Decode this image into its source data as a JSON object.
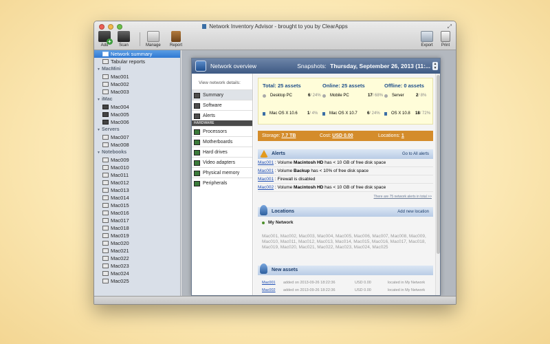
{
  "window": {
    "title": "Network Inventory Advisor - brought to you by ClearApps"
  },
  "toolbar": {
    "add": "Add",
    "scan": "Scan",
    "manage": "Manage",
    "report": "Report",
    "export": "Export",
    "print": "Print"
  },
  "sidebar": {
    "summary_items": [
      {
        "label": "Network summary",
        "icon": "network-icon"
      },
      {
        "label": "Tabular reports",
        "icon": "table-icon"
      }
    ],
    "groups": [
      {
        "name": "MacMini",
        "items": [
          "Mac001",
          "Mac002",
          "Mac003"
        ]
      },
      {
        "name": "iMac",
        "items": [
          "Mac004",
          "Mac005",
          "Mac006"
        ]
      },
      {
        "name": "Servers",
        "items": [
          "Mac007",
          "Mac008"
        ]
      },
      {
        "name": "Notebooks",
        "items": [
          "Mac009",
          "Mac010",
          "Mac011",
          "Mac012",
          "Mac013",
          "Mac014",
          "Mac015",
          "Mac016",
          "Mac017",
          "Mac018",
          "Mac019",
          "Mac020",
          "Mac021",
          "Mac022",
          "Mac023",
          "Mac024",
          "Mac025"
        ]
      }
    ]
  },
  "panel": {
    "title": "Network overview",
    "snapshot_label": "Snapshots:",
    "snapshot_value": "Thursday, September 26, 2013 (11:..."
  },
  "nav": {
    "caption": "View network details:",
    "items": [
      "Summary",
      "Software",
      "Alerts"
    ],
    "hardware_section": "HARDWARE",
    "hardware_items": [
      "Processors",
      "Motherboards",
      "Hard drives",
      "Video adapters",
      "Physical memory",
      "Peripherals"
    ]
  },
  "summary": {
    "total": "Total: 25 assets",
    "online": "Online: 25 assets",
    "offline": "Offline: 0 assets",
    "rows": [
      {
        "label": "Desktop PC",
        "value": "6",
        "pct": "/ 24%"
      },
      {
        "label": "Mobile PC",
        "value": "17",
        "pct": "/ 68%"
      },
      {
        "label": "Server",
        "value": "2",
        "pct": "/ 8%"
      },
      {
        "label": "Mac OS X 10.6",
        "value": "1",
        "pct": "/ 4%"
      },
      {
        "label": "Mac OS X 10.7",
        "value": "6",
        "pct": "/ 24%"
      },
      {
        "label": "OS X 10.8",
        "value": "18",
        "pct": "/ 72%"
      }
    ]
  },
  "storage": {
    "storage_label": "Storage:",
    "storage_value": "7.7 TB",
    "cost_label": "Cost:",
    "cost_value": "USD 0.00",
    "locations_label": "Locations:",
    "locations_value": "1"
  },
  "alerts": {
    "title": "Alerts",
    "link": "Go to All alerts",
    "items": [
      {
        "mac": "Mac001",
        "pre": " : Volume ",
        "bold": "Macintosh HD",
        "post": " has < 10 GB of free disk space"
      },
      {
        "mac": "Mac001",
        "pre": " : Volume ",
        "bold": "Backup",
        "post": " has < 10% of free disk space"
      },
      {
        "mac": "Mac001",
        "pre": " : Firewall is disabled",
        "bold": "",
        "post": ""
      },
      {
        "mac": "Mac002",
        "pre": " : Volume ",
        "bold": "Macintosh HD",
        "post": " has < 10 GB of free disk space"
      }
    ],
    "more": "There are 75 network alerts in total >>"
  },
  "locations": {
    "title": "Locations",
    "link": "Add new location",
    "name": "My Network",
    "members": "Mac001, Mac002, Mac003, Mac004, Mac005, Mac006, Mac007, Mac008, Mac009, Mac010, Mac011, Mac012, Mac013, Mac014, Mac015, Mac016, Mac017, Mac018, Mac019, Mac020, Mac021, Mac022, Mac023, Mac024, Mac025"
  },
  "new_assets": {
    "title": "New assets",
    "items": [
      {
        "mac": "Mac001",
        "added": "added on 2013-09-26 18:22:36",
        "cost": "USD 0.00",
        "location": "located in My Network"
      },
      {
        "mac": "Mac002",
        "added": "added on 2013-09-26 18:22:36",
        "cost": "USD 0.00",
        "location": "located in My Network"
      }
    ]
  }
}
